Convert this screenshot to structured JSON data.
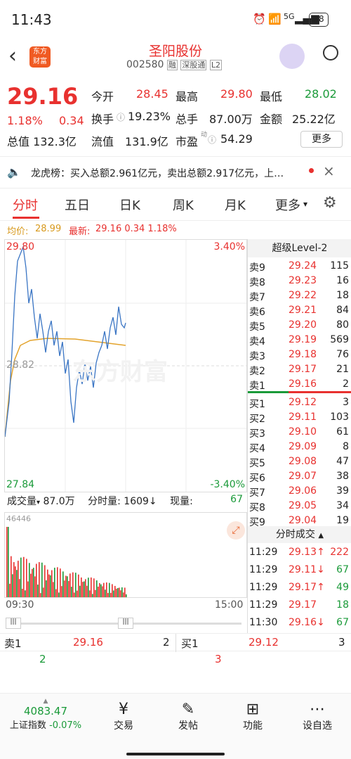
{
  "status": {
    "time": "11:43",
    "battery": "58",
    "net": "5G"
  },
  "header": {
    "logo_line1": "东方",
    "logo_line2": "财富",
    "title": "圣阳股份",
    "code": "002580",
    "tag1": "融",
    "tag2": "深股通",
    "tag3": "L2"
  },
  "quote": {
    "price": "29.16",
    "pct": "1.18%",
    "chg": "0.34",
    "open_l": "今开",
    "open": "28.45",
    "high_l": "最高",
    "high": "29.80",
    "low_l": "最低",
    "low": "28.02",
    "turn_l": "换手",
    "turn": "19.23%",
    "vol_l": "总手",
    "vol": "87.00万",
    "amt_l": "金额",
    "amt": "25.22亿",
    "mcap_l": "总值",
    "mcap": "132.3亿",
    "fcap_l": "流值",
    "fcap": "131.9亿",
    "pe_l": "市盈",
    "pe_sup": "动",
    "pe": "54.29",
    "more": "更多"
  },
  "news": {
    "text": "龙虎榜：买入总额2.961亿元，卖出总额2.917亿元，上…"
  },
  "tabs": [
    "分时",
    "五日",
    "日K",
    "周K",
    "月K",
    "更多"
  ],
  "info": {
    "avg_l": "均价:",
    "avg": "28.99",
    "last_l": "最新:",
    "last": "29.16 0.34 1.18%"
  },
  "chart": {
    "hi": "29.80",
    "lo": "27.84",
    "mid": "28.82",
    "hi_pct": "3.40%",
    "lo_pct": "-3.40%",
    "watermark": "东方财富"
  },
  "volbar": {
    "label": "成交量",
    "val": "87.0万",
    "ftl": "分时量:",
    "ftv": "1609",
    "xl": "现量:",
    "xv": "67",
    "max": "46446",
    "t0": "09:30",
    "t1": "15:00"
  },
  "book": {
    "title": "超级Level-2",
    "asks": [
      [
        "卖9",
        "29.24",
        "115"
      ],
      [
        "卖8",
        "29.23",
        "16"
      ],
      [
        "卖7",
        "29.22",
        "18"
      ],
      [
        "卖6",
        "29.21",
        "84"
      ],
      [
        "卖5",
        "29.20",
        "80"
      ],
      [
        "卖4",
        "29.19",
        "569"
      ],
      [
        "卖3",
        "29.18",
        "76"
      ],
      [
        "卖2",
        "29.17",
        "21"
      ],
      [
        "卖1",
        "29.16",
        "2"
      ]
    ],
    "bids": [
      [
        "买1",
        "29.12",
        "3"
      ],
      [
        "买2",
        "29.11",
        "103"
      ],
      [
        "买3",
        "29.10",
        "61"
      ],
      [
        "买4",
        "29.09",
        "8"
      ],
      [
        "买5",
        "29.08",
        "47"
      ],
      [
        "买6",
        "29.07",
        "38"
      ],
      [
        "买7",
        "29.06",
        "39"
      ],
      [
        "买8",
        "29.05",
        "34"
      ],
      [
        "买9",
        "29.04",
        "19"
      ]
    ],
    "trade_title": "分时成交",
    "trades": [
      [
        "11:29",
        "29.13↑",
        "222"
      ],
      [
        "11:29",
        "29.11↓",
        "67"
      ],
      [
        "11:29",
        "29.17↑",
        "49"
      ],
      [
        "11:29",
        "29.17",
        "18"
      ],
      [
        "11:30",
        "29.16↓",
        "67"
      ]
    ]
  },
  "lvl1": {
    "s_l": "卖1",
    "s_p": "29.16",
    "s_v": "2",
    "b_l": "买1",
    "b_p": "29.12",
    "b_v": "3",
    "n1": "2",
    "n2": "3"
  },
  "bottom": {
    "idx": "4083.47",
    "idx_name": "上证指数",
    "idx_chg": "-0.07%",
    "nav": [
      "交易",
      "发帖",
      "功能",
      "设自选"
    ]
  }
}
